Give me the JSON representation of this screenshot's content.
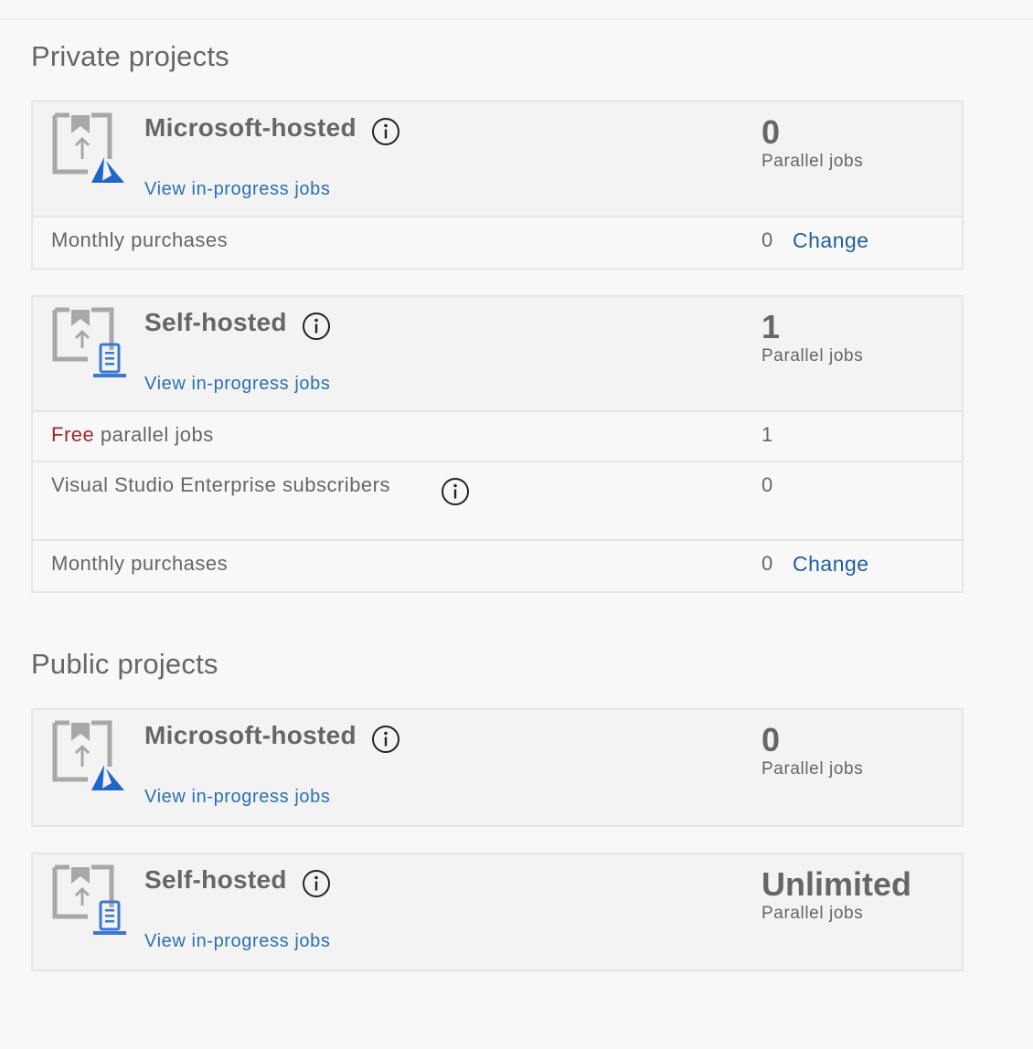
{
  "private": {
    "title": "Private projects",
    "microsoft_hosted": {
      "name": "Microsoft-hosted",
      "link": "View in-progress jobs",
      "count": "0",
      "count_label": "Parallel jobs",
      "monthly_label": "Monthly purchases",
      "monthly_value": "0",
      "change": "Change"
    },
    "self_hosted": {
      "name": "Self-hosted",
      "link": "View in-progress jobs",
      "count": "1",
      "count_label": "Parallel jobs",
      "free_word": "Free",
      "free_rest": " parallel jobs",
      "free_value": "1",
      "vs_label": "Visual Studio Enterprise subscribers",
      "vs_value": "0",
      "monthly_label": "Monthly purchases",
      "monthly_value": "0",
      "change": "Change"
    }
  },
  "public": {
    "title": "Public projects",
    "microsoft_hosted": {
      "name": "Microsoft-hosted",
      "link": "View in-progress jobs",
      "count": "0",
      "count_label": "Parallel jobs"
    },
    "self_hosted": {
      "name": "Self-hosted",
      "link": "View in-progress jobs",
      "count": "Unlimited",
      "count_label": "Parallel jobs"
    }
  },
  "colors": {
    "link": "#2a6fb8",
    "free": "#a4262c",
    "azure": "#1e66c9"
  }
}
